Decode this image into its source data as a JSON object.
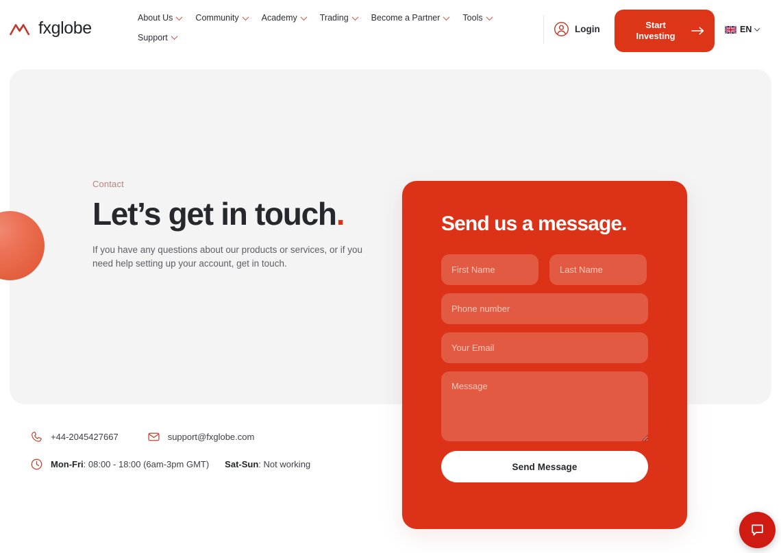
{
  "header": {
    "logo_text": "fxglobe",
    "nav_items": [
      {
        "label": "About Us",
        "has_chevron": true
      },
      {
        "label": "Community",
        "has_chevron": true
      },
      {
        "label": "Academy",
        "has_chevron": true
      },
      {
        "label": "Trading",
        "has_chevron": true
      },
      {
        "label": "Become a Partner",
        "has_chevron": true
      },
      {
        "label": "Tools",
        "has_chevron": true
      },
      {
        "label": "Support",
        "has_chevron": true
      }
    ],
    "login_label": "Login",
    "cta_label": "Start\nInvesting",
    "lang_code": "EN"
  },
  "hero": {
    "eyebrow": "Contact",
    "title": "Let’s get in touch",
    "title_dot": ".",
    "subtitle": "If you have any questions about our products or services, or if you need help setting up your account, get in touch."
  },
  "form": {
    "title": "Send us a message.",
    "fields": {
      "first_name_placeholder": "First Name",
      "first_name_value": "",
      "last_name_placeholder": "Last Name",
      "last_name_value": "",
      "phone_placeholder": "Phone number",
      "phone_value": "",
      "email_placeholder": "Your Email",
      "email_value": "",
      "message_placeholder": "Message",
      "message_value": ""
    },
    "submit_label": "Send Message"
  },
  "contact": {
    "phone": "+44-2045427667",
    "email": "support@fxglobe.com",
    "hours_weekday_label": "Mon-Fri",
    "hours_weekday_value": ": 08:00 - 18:00 (6am-3pm GMT)",
    "hours_weekend_label": "Sat-Sun",
    "hours_weekend_value": ": Not working"
  },
  "colors": {
    "brand_red": "#dc3318",
    "cta_red": "#dd3518",
    "input_red": "#e25a42",
    "panel_gray": "#f4f4f4",
    "chat_red": "#d01b12",
    "sphere_coral": "#ec7154",
    "eyebrow_rose": "#b6837b",
    "text_dark": "#26282d"
  },
  "icons": {
    "logo": "mountain-peaks-icon",
    "login": "user-circle-icon",
    "cta": "arrow-right-icon",
    "lang": "uk-flag-icon",
    "phone": "phone-icon",
    "email": "envelope-icon",
    "clock": "clock-icon",
    "chat": "chat-bubble-icon"
  }
}
